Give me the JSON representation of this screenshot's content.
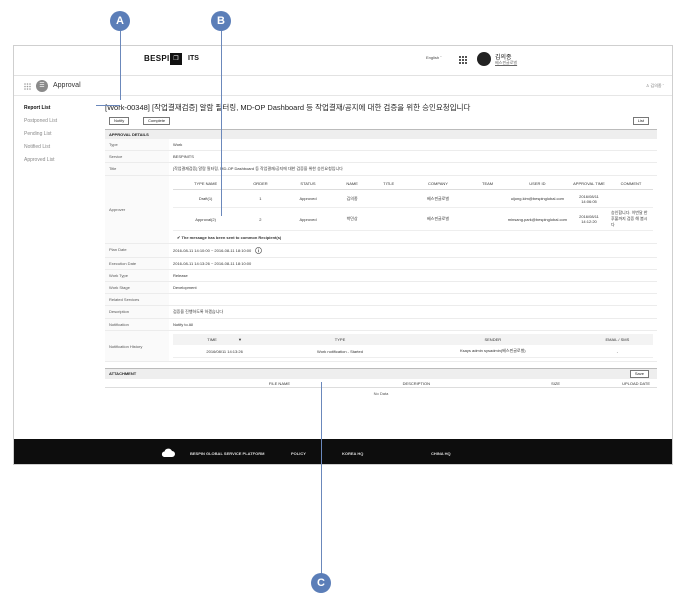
{
  "header": {
    "brand": "BESPIN",
    "brand_logo": "❐",
    "product": "ITS",
    "language": "English ˇ",
    "user_name": "김의종",
    "user_org": "베스핀글로벌"
  },
  "appbar": {
    "app_icon_glyph": "☰",
    "title": "Approval",
    "user": "♙ 김의종 ˇ"
  },
  "sidebar": {
    "items": [
      {
        "label": "Report List"
      },
      {
        "label": "Postponed List"
      },
      {
        "label": "Pending List"
      },
      {
        "label": "Notified List"
      },
      {
        "label": "Approved List"
      }
    ]
  },
  "page": {
    "title": "[Work-00348] [작업결재검증] 알람 필터링, MD-OP Dashboard 등 작업결재/공지에 대한 검증을 위한 승인요청입니다"
  },
  "toolbar": {
    "notify": "Notify",
    "complete": "Complete",
    "list": "List"
  },
  "details": {
    "section_title": "APPROVAL DETAILS",
    "type_label": "Type",
    "type_value": "Work",
    "service_label": "Service",
    "service_value": "BESPINITS",
    "title_label": "Title",
    "title_value": "[작업결재검증] 알람 필터링, MD-OP Dashboard 등 작업결재/공지에 대한 검증을 위한 승인요청입니다",
    "approver_label": "Approver",
    "plan_label": "Plan Date",
    "plan_value": "2016-08-11 14:10:00 ~ 2016-08-11 18:10:00",
    "exec_label": "Execution Date",
    "exec_value": "2016-08-11 14:13:26 ~ 2016-08-11 18:10:00",
    "worktype_label": "Work Type",
    "worktype_value": "Release",
    "workstage_label": "Work Stage",
    "workstage_value": "Development",
    "related_label": "Related Services",
    "related_value": "",
    "desc_label": "Description",
    "desc_value": "검증을 진행하도록 하겠습니다",
    "notification_label": "Notification",
    "notification_value": "Notify to All",
    "history_label": "Notification History"
  },
  "approvers": {
    "columns": [
      "TYPE NAME",
      "ORDER",
      "STATUS",
      "NAME",
      "TITLE",
      "COMPANY",
      "TEAM",
      "USER ID",
      "APPROVAL TIME",
      "COMMENT"
    ],
    "rows": [
      {
        "type_name": "Draft(1)",
        "order": "1",
        "status": "Approved",
        "name": "김의종",
        "title": "",
        "company": "베스핀글로벌",
        "team": "",
        "user_id": "uijong.kim@bespinglobal.com",
        "time": "2016/08/11 14:06:05",
        "comment": ""
      },
      {
        "type_name": "Approval(2)",
        "order": "2",
        "status": "Approved",
        "name": "박민상",
        "title": "",
        "company": "베스핀글로벌",
        "team": "",
        "user_id": "minsang.park@bespinglobal.com",
        "time": "2016/08/11 14:12:20",
        "comment": "승인합니다. 이번달 한 후불까지 검증 해 봅시다"
      }
    ],
    "note": "✔ The message has been sent to common Recipient(s)"
  },
  "notif_history": {
    "columns": {
      "time": "TIME",
      "type": "TYPE",
      "sender": "SENDER",
      "email": "EMAIL / SMS"
    },
    "sort_glyph": "▼",
    "rows": [
      {
        "time": "2016/08/11 14:13:26",
        "type": "Work notification - Started",
        "sender": "Ksays admin sysadmin(베스핀글로벌)",
        "email": "-"
      }
    ]
  },
  "attachment": {
    "section_title": "ATTACHMENT",
    "save": "Save",
    "columns": {
      "file_name": "FILE NAME",
      "description": "DESCRIPTION",
      "size": "SIZE",
      "upload_date": "UPLOAD DATE"
    },
    "empty": "No Data"
  },
  "footer": {
    "platform": "BESPIN GLOBAL SERVICE PLATFORM",
    "policy": "POLICY",
    "korea": "KOREA HQ",
    "china": "CHINA HQ"
  },
  "markers": {
    "a": "A",
    "b": "B",
    "c": "C"
  },
  "colors": {
    "marker": "#5b7eb8",
    "footer_bg": "#0d0d0d",
    "link": "#3a68b0"
  }
}
